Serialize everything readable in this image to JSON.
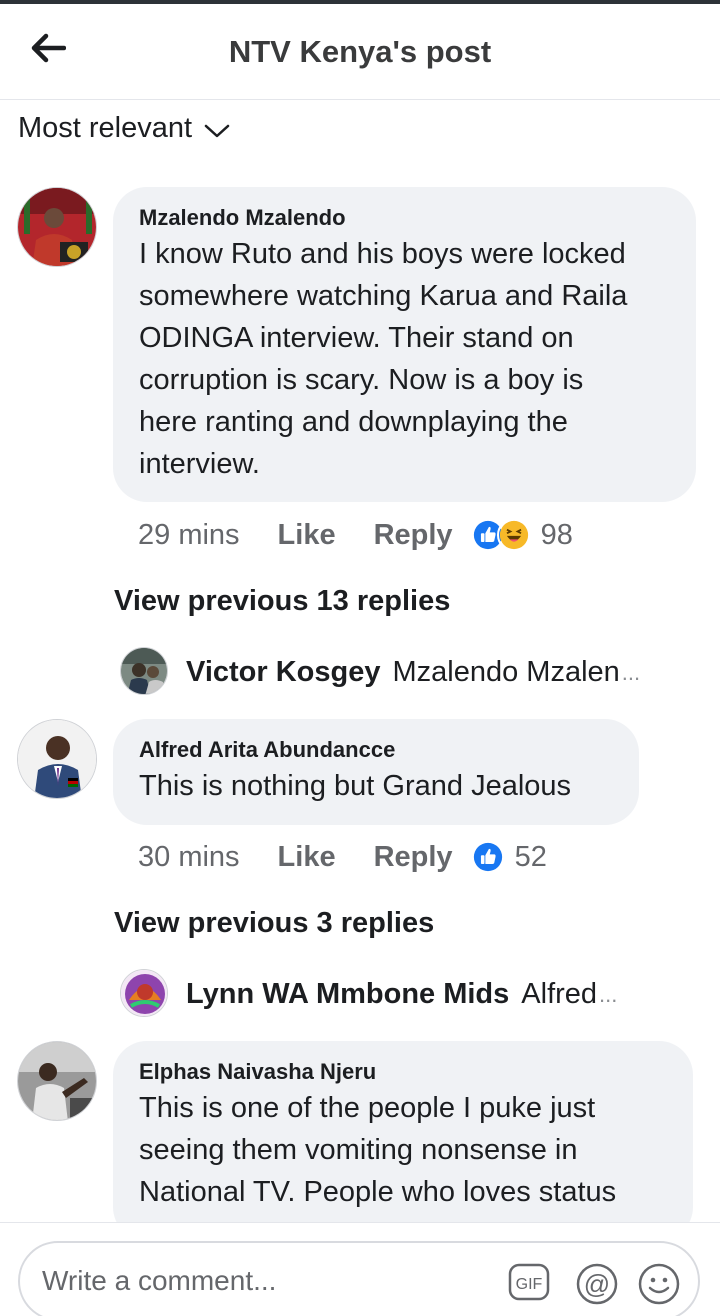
{
  "header": {
    "title": "NTV Kenya's post",
    "back_icon": "back-arrow-icon"
  },
  "sort": {
    "label": "Most relevant",
    "icon": "chevron-down-icon"
  },
  "comments": [
    {
      "author": "Mzalendo Mzalendo",
      "lines": [
        "I know Ruto and his boys were locked",
        "somewhere watching Karua and Raila",
        "ODINGA interview. Their stand on",
        "corruption is scary. Now is a boy is",
        "here ranting and downplaying the",
        "interview."
      ],
      "time": "29 mins",
      "like_label": "Like",
      "reply_label": "Reply",
      "reactions": [
        "like-icon",
        "haha-icon"
      ],
      "reaction_count": "98",
      "view_previous": "View previous 13 replies",
      "latest_reply": {
        "author": "Victor Kosgey",
        "text": "Mzalendo Mzalen",
        "ellipsis": "..."
      }
    },
    {
      "author": "Alfred Arita Abundancce",
      "lines": [
        "This is nothing but Grand Jealous"
      ],
      "time": "30 mins",
      "like_label": "Like",
      "reply_label": "Reply",
      "reactions": [
        "like-icon"
      ],
      "reaction_count": "52",
      "view_previous": "View previous 3 replies",
      "latest_reply": {
        "author": "Lynn WA Mmbone Mids",
        "text": "Alfred",
        "ellipsis": "..."
      }
    },
    {
      "author": "Elphas Naivasha Njeru",
      "lines": [
        "This is one of the people I puke just",
        "seeing them vomiting nonsense in",
        "National TV. People who loves status"
      ]
    }
  ],
  "composer": {
    "placeholder": "Write a comment...",
    "gif_label": "GIF",
    "mention_label": "@",
    "icons": [
      "gif-icon",
      "mention-icon",
      "emoji-icon"
    ]
  },
  "colors": {
    "like_blue": "#1877f2",
    "haha_yellow": "#f7b928",
    "bubble_bg": "#f0f2f5",
    "meta_grey": "#65676b"
  }
}
